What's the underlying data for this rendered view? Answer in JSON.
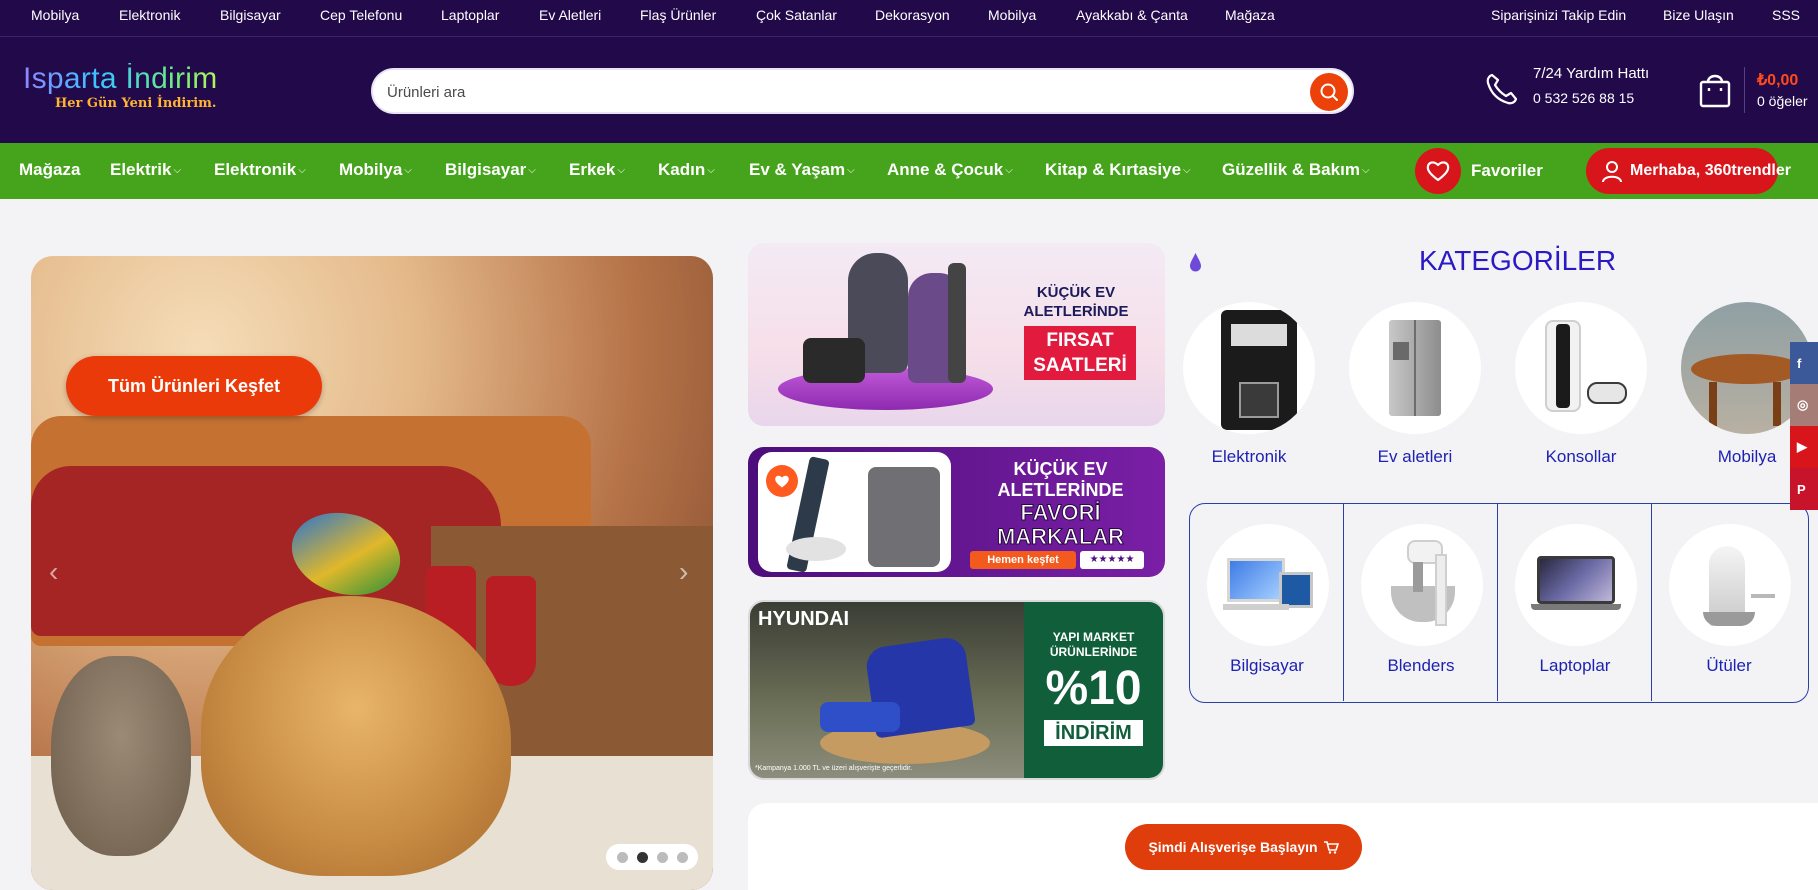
{
  "topbar": {
    "links": [
      "Mobilya",
      "Elektronik",
      "Bilgisayar",
      "Cep Telefonu",
      "Laptoplar",
      "Ev Aletleri",
      "Flaş Ürünler",
      "Çok Satanlar",
      "Dekorasyon",
      "Mobilya",
      "Ayakkabı & Çanta",
      "Mağaza"
    ],
    "right_links": [
      "Siparişinizi Takip Edin",
      "Bize Ulaşın",
      "SSS"
    ]
  },
  "header": {
    "logo_title": "Isparta İndirim",
    "logo_tagline": "Her Gün Yeni İndirim.",
    "search_placeholder": "Ürünleri ara",
    "help_title": "7/24 Yardım Hattı",
    "help_phone": "0 532 526 88 15",
    "cart_total": "₺0,00",
    "cart_count": "0 öğeler"
  },
  "nav": {
    "items": [
      {
        "label": "Mağaza",
        "caret": false
      },
      {
        "label": "Elektrik",
        "caret": true
      },
      {
        "label": "Elektronik",
        "caret": true
      },
      {
        "label": "Mobilya",
        "caret": true
      },
      {
        "label": "Bilgisayar",
        "caret": true
      },
      {
        "label": "Erkek",
        "caret": true
      },
      {
        "label": "Kadın",
        "caret": true
      },
      {
        "label": "Ev & Yaşam",
        "caret": true
      },
      {
        "label": "Anne & Çocuk",
        "caret": true
      },
      {
        "label": "Kitap & Kırtasiye",
        "caret": true
      },
      {
        "label": "Güzellik & Bakım",
        "caret": true
      }
    ],
    "favorites_label": "Favoriler",
    "account_label": "Merhaba, 360trendler"
  },
  "hero": {
    "cta_label": "Tüm Ürünleri Keşfet",
    "active_slide": 2,
    "slide_count": 4
  },
  "banners": {
    "b1_heading": "KÜÇÜK EV ALETLERİNDE",
    "b1_tag": "FIRSAT SAATLERİ",
    "b2_heading": "KÜÇÜK EV ALETLERİNDE",
    "b2_tag": "FAVORİ MARKALAR",
    "b2_button": "Hemen keşfet",
    "b2_stars": "★★★★★",
    "b3_brand": "HYUNDAI",
    "b3_line": "YAPI MARKET ÜRÜNLERİNDE",
    "b3_percent": "%10",
    "b3_word": "İNDİRİM",
    "b3_fine": "*Kampanya 1.000 TL ve üzeri alışverişte geçerlidir."
  },
  "categories": {
    "title": "KATEGORİLER",
    "top": [
      "Elektronik",
      "Ev aletleri",
      "Konsollar",
      "Mobilya"
    ],
    "grid": [
      "Bilgisayar",
      "Blenders",
      "Laptoplar",
      "Ütüler"
    ]
  },
  "social": [
    "f",
    "◎",
    "▶",
    "P"
  ],
  "colors": {
    "topbar_bg": "#22094a",
    "nav_green": "#46a31c",
    "accent_orange": "#ea3a0a",
    "accent_red": "#d8151b",
    "category_blue": "#1e22b0"
  },
  "cta_bottom": {
    "label": "Şimdi Alışverişe Başlayın"
  }
}
